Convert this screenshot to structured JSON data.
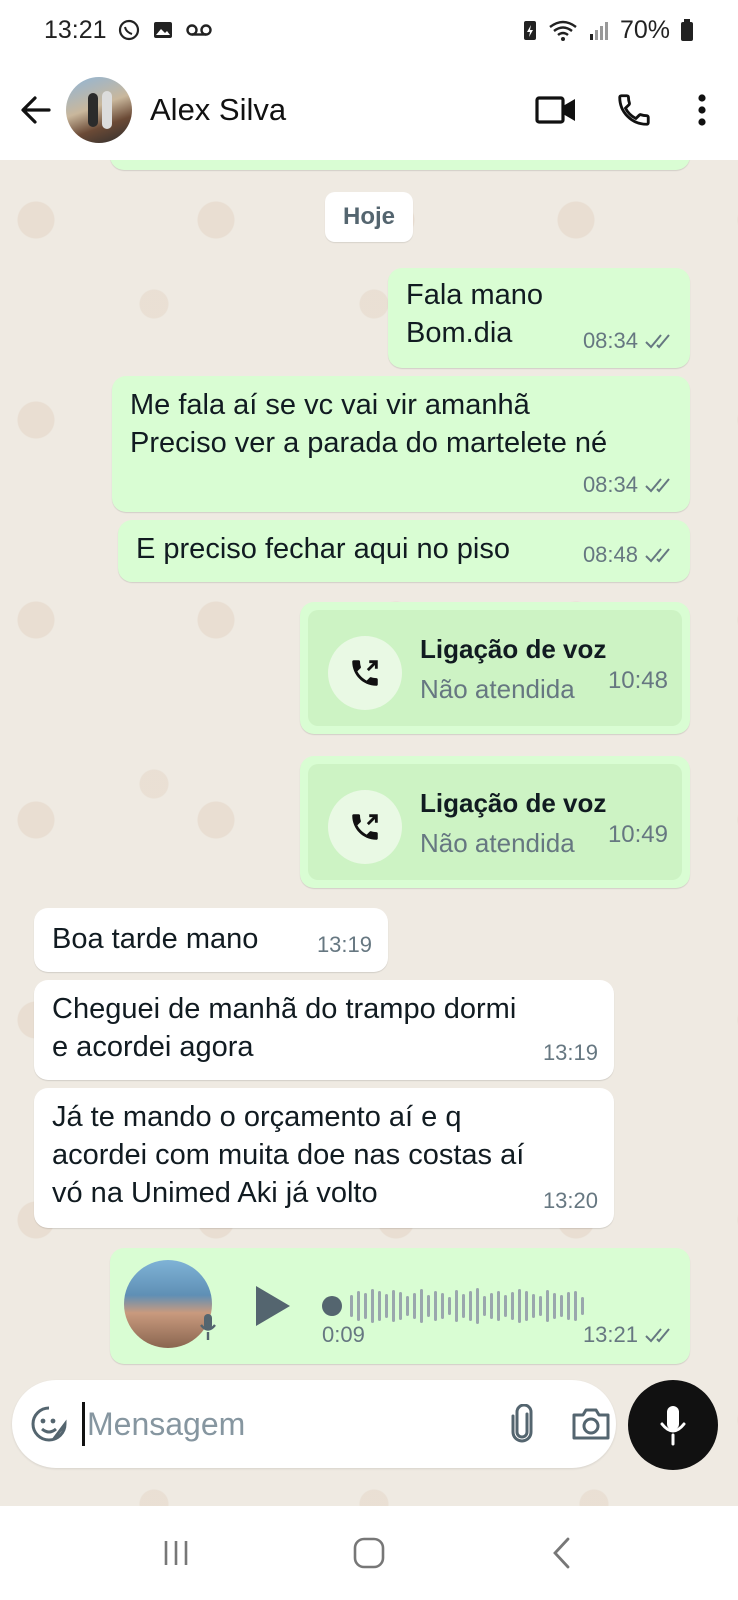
{
  "status_bar": {
    "time": "13:21",
    "battery": "70%",
    "icons": [
      "whatsapp-icon",
      "gallery-icon",
      "voicemail-icon",
      "battery-saver-icon",
      "wifi-icon",
      "signal-icon",
      "battery-icon"
    ]
  },
  "header": {
    "contact_name": "Alex Silva",
    "icons": [
      "back-arrow-icon",
      "video-call-icon",
      "phone-icon",
      "more-vert-icon"
    ]
  },
  "chat": {
    "date_chip": "Hoje",
    "messages": [
      {
        "dir": "out",
        "lines": [
          "Fala mano",
          "Bom.dia"
        ],
        "time": "08:34"
      },
      {
        "dir": "out",
        "lines": [
          "Me fala aí se vc vai vir amanhã",
          "Preciso ver a parada do martelete né"
        ],
        "time": "08:34"
      },
      {
        "dir": "out",
        "lines": [
          "E preciso fechar aqui no piso"
        ],
        "time": "08:48"
      },
      {
        "dir": "out",
        "type": "call",
        "title": "Ligação de voz",
        "subtitle": "Não atendida",
        "time": "10:48"
      },
      {
        "dir": "out",
        "type": "call",
        "title": "Ligação de voz",
        "subtitle": "Não atendida",
        "time": "10:49"
      },
      {
        "dir": "in",
        "lines": [
          "Boa tarde mano"
        ],
        "time": "13:19"
      },
      {
        "dir": "in",
        "lines": [
          "Cheguei de manhã do trampo dormi",
          "e acordei agora"
        ],
        "time": "13:19"
      },
      {
        "dir": "in",
        "lines": [
          "Já te mando o orçamento aí e q",
          "acordei com muita doe nas costas aí",
          "vó na Unimed Aki já volto"
        ],
        "time": "13:20"
      },
      {
        "dir": "out",
        "type": "voice",
        "duration": "0:09",
        "time": "13:21"
      }
    ]
  },
  "input": {
    "placeholder": "Mensagem",
    "value": ""
  },
  "nav": {
    "icons": [
      "recent-apps-icon",
      "home-icon",
      "back-icon"
    ]
  },
  "colors": {
    "outgoing_bubble": "#d9fdd3",
    "incoming_bubble": "#ffffff",
    "chat_bg": "#efeae2",
    "read_ticks": "#667781",
    "mic_button": "#111111"
  }
}
